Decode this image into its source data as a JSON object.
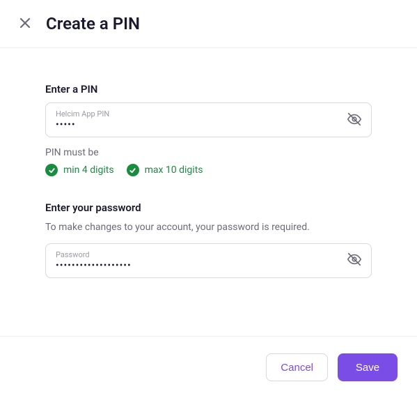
{
  "header": {
    "title": "Create a PIN"
  },
  "pin_section": {
    "label": "Enter a PIN",
    "input_label": "Helcim App PIN",
    "input_value": "•••••"
  },
  "requirements": {
    "title": "PIN must be",
    "items": [
      {
        "text": "min 4 digits"
      },
      {
        "text": "max 10 digits"
      }
    ]
  },
  "password_section": {
    "label": "Enter your password",
    "description": "To make changes to your account, your password is required.",
    "input_label": "Password",
    "input_value": "•••••••••••••••••••"
  },
  "footer": {
    "cancel": "Cancel",
    "save": "Save"
  }
}
